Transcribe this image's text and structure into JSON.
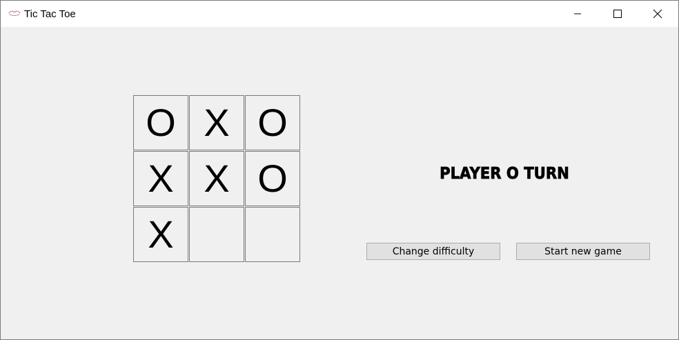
{
  "window": {
    "title": "Tic Tac Toe",
    "app_icon": "game-icon",
    "controls": [
      "minimize-icon",
      "maximize-icon",
      "close-icon"
    ]
  },
  "board": {
    "cells": [
      [
        "O",
        "X",
        "O"
      ],
      [
        "X",
        "X",
        "O"
      ],
      [
        "X",
        "",
        ""
      ]
    ]
  },
  "status": {
    "text": "PLAYER O TURN"
  },
  "buttons": {
    "change_difficulty": "Change difficulty",
    "start_new_game": "Start new game"
  }
}
